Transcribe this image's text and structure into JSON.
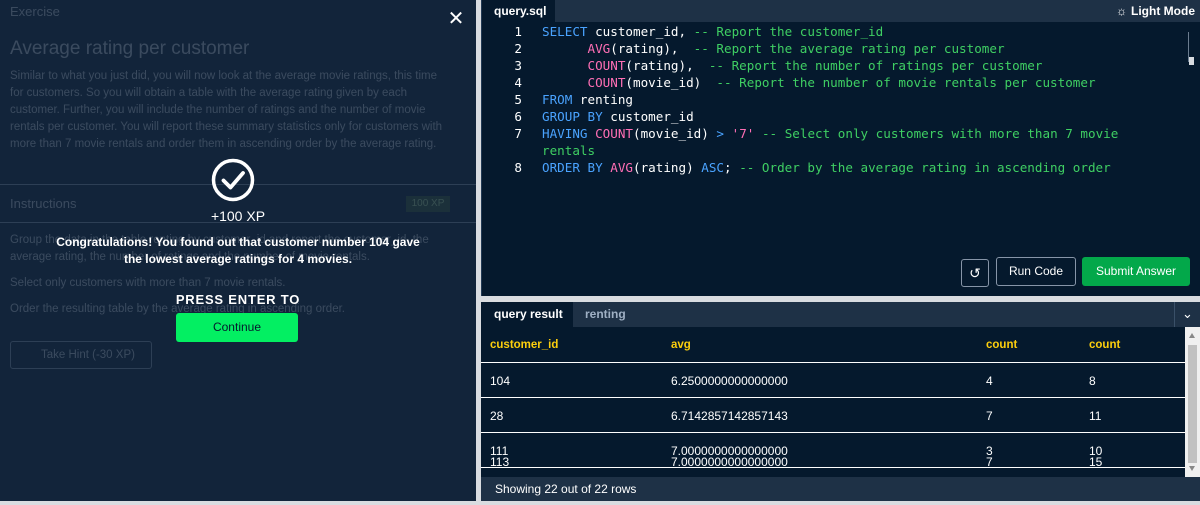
{
  "background_exercise": {
    "header": "Exercise",
    "title": "Average rating per customer",
    "paragraph": "Similar to what you just did, you will now look at the average movie ratings, this time for customers. So you will obtain a table with the average rating given by each customer. Further, you will include the number of ratings and the number of movie rentals per customer. You will report these summary statistics only for customers with more than 7 movie rentals and order them in ascending order by the average rating.",
    "instructions": "Instructions",
    "xp_badge": "100 XP",
    "bullets": [
      "Group the data in the table renting by customer_id and report the customer_id, the average rating, the number of ratings and the number of movie rentals.",
      "Select only customers with more than 7 movie rentals.",
      "Order the resulting table by the average rating in ascending order."
    ],
    "hint": "Take Hint (-30 XP)"
  },
  "modal": {
    "close_icon": "close-icon",
    "xp": "+100 XP",
    "message": "Congratulations! You found out that customer number 104 gave the lowest average ratings for 4 movies.",
    "press_enter": "PRESS ENTER TO",
    "continue": "Continue"
  },
  "editor": {
    "tab": "query.sql",
    "light_mode": "Light Mode",
    "line_numbers": [
      "1",
      "2",
      "3",
      "4",
      "5",
      "6",
      "7",
      "",
      "8"
    ],
    "lines": [
      [
        {
          "t": "SELECT",
          "c": "kw"
        },
        {
          "t": " customer_id, ",
          "c": ""
        },
        {
          "t": "-- Report the customer_id",
          "c": "cm"
        }
      ],
      [
        {
          "t": "      ",
          "c": ""
        },
        {
          "t": "AVG",
          "c": "st"
        },
        {
          "t": "(rating),  ",
          "c": ""
        },
        {
          "t": "-- Report the average rating per customer",
          "c": "cm"
        }
      ],
      [
        {
          "t": "      ",
          "c": ""
        },
        {
          "t": "COUNT",
          "c": "st"
        },
        {
          "t": "(rating),  ",
          "c": ""
        },
        {
          "t": "-- Report the number of ratings per customer",
          "c": "cm"
        }
      ],
      [
        {
          "t": "      ",
          "c": ""
        },
        {
          "t": "COUNT",
          "c": "st"
        },
        {
          "t": "(movie_id)  ",
          "c": ""
        },
        {
          "t": "-- Report the number of movie rentals per customer",
          "c": "cm"
        }
      ],
      [
        {
          "t": "FROM",
          "c": "kw"
        },
        {
          "t": " renting",
          "c": ""
        }
      ],
      [
        {
          "t": "GROUP BY",
          "c": "kw"
        },
        {
          "t": " customer_id",
          "c": ""
        }
      ],
      [
        {
          "t": "HAVING",
          "c": "kw"
        },
        {
          "t": " ",
          "c": ""
        },
        {
          "t": "COUNT",
          "c": "st"
        },
        {
          "t": "(movie_id) ",
          "c": ""
        },
        {
          "t": ">",
          "c": "kw"
        },
        {
          "t": " ",
          "c": ""
        },
        {
          "t": "'7'",
          "c": "st"
        },
        {
          "t": " ",
          "c": ""
        },
        {
          "t": "-- Select only customers with more than 7 movie",
          "c": "cm"
        }
      ],
      [
        {
          "t": "rentals",
          "c": "cm"
        }
      ],
      [
        {
          "t": "ORDER BY",
          "c": "kw"
        },
        {
          "t": " ",
          "c": ""
        },
        {
          "t": "AVG",
          "c": "st"
        },
        {
          "t": "(rating) ",
          "c": ""
        },
        {
          "t": "ASC",
          "c": "kw"
        },
        {
          "t": "; ",
          "c": ""
        },
        {
          "t": "-- Order by the average rating in ascending order",
          "c": "cm"
        }
      ]
    ],
    "reset_icon": "reset-icon",
    "run_code": "Run Code",
    "submit_answer": "Submit Answer"
  },
  "results": {
    "tabs": [
      "query result",
      "renting"
    ],
    "columns": [
      "customer_id",
      "avg",
      "count",
      "count"
    ],
    "rows": [
      [
        "104",
        "6.2500000000000000",
        "4",
        "8"
      ],
      [
        "28",
        "6.7142857142857143",
        "7",
        "11"
      ],
      [
        "111",
        "7.0000000000000000",
        "3",
        "10"
      ],
      [
        "113",
        "7.0000000000000000",
        "7",
        "15"
      ]
    ],
    "footer": "Showing 22 out of 22 rows"
  },
  "colors": {
    "accent_green": "#03ef62",
    "submit_green": "#03a84a",
    "header_yellow": "#fcce0d",
    "panel_navy": "#05192d"
  }
}
